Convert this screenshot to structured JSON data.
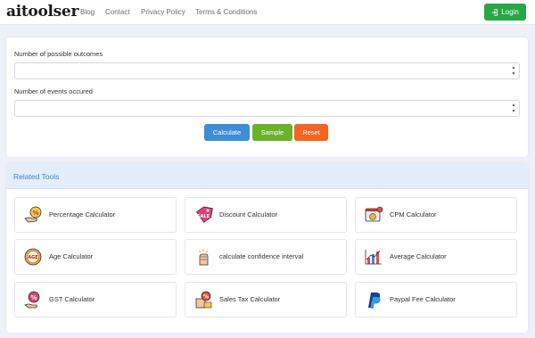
{
  "brand": "aitoolser",
  "nav": {
    "links": [
      "Blog",
      "Contact",
      "Privacy Policy",
      "Terms & Conditions"
    ],
    "login_label": "Login"
  },
  "form": {
    "field1_label": "Number of possible outcomes",
    "field1_value": "",
    "field2_label": "Number of events occured",
    "field2_value": "",
    "calculate_label": "Calculate",
    "sample_label": "Sample",
    "reset_label": "Reset"
  },
  "related": {
    "title": "Related Tools",
    "tools": [
      {
        "name": "Percentage Calculator",
        "icon": "percentage-hand-icon"
      },
      {
        "name": "Discount Calculator",
        "icon": "discount-tag-icon"
      },
      {
        "name": "CPM Calculator",
        "icon": "cpm-browser-icon"
      },
      {
        "name": "Age Calculator",
        "icon": "age-badge-icon"
      },
      {
        "name": "calculate confidence interval",
        "icon": "confidence-fist-icon"
      },
      {
        "name": "Average Calculator",
        "icon": "average-chart-icon"
      },
      {
        "name": "GST Calculator",
        "icon": "gst-percent-icon"
      },
      {
        "name": "Sales Tax Calculator",
        "icon": "sales-tax-icon"
      },
      {
        "name": "Paypal Fee Calculator",
        "icon": "paypal-icon"
      }
    ]
  },
  "colors": {
    "login": "#28a745",
    "calculate": "#3d8ed6",
    "sample": "#6cb02e",
    "reset": "#f26522",
    "related_title": "#3a7fd0",
    "paypal_dark": "#1b3f8f",
    "paypal_light": "#2d9de0"
  }
}
